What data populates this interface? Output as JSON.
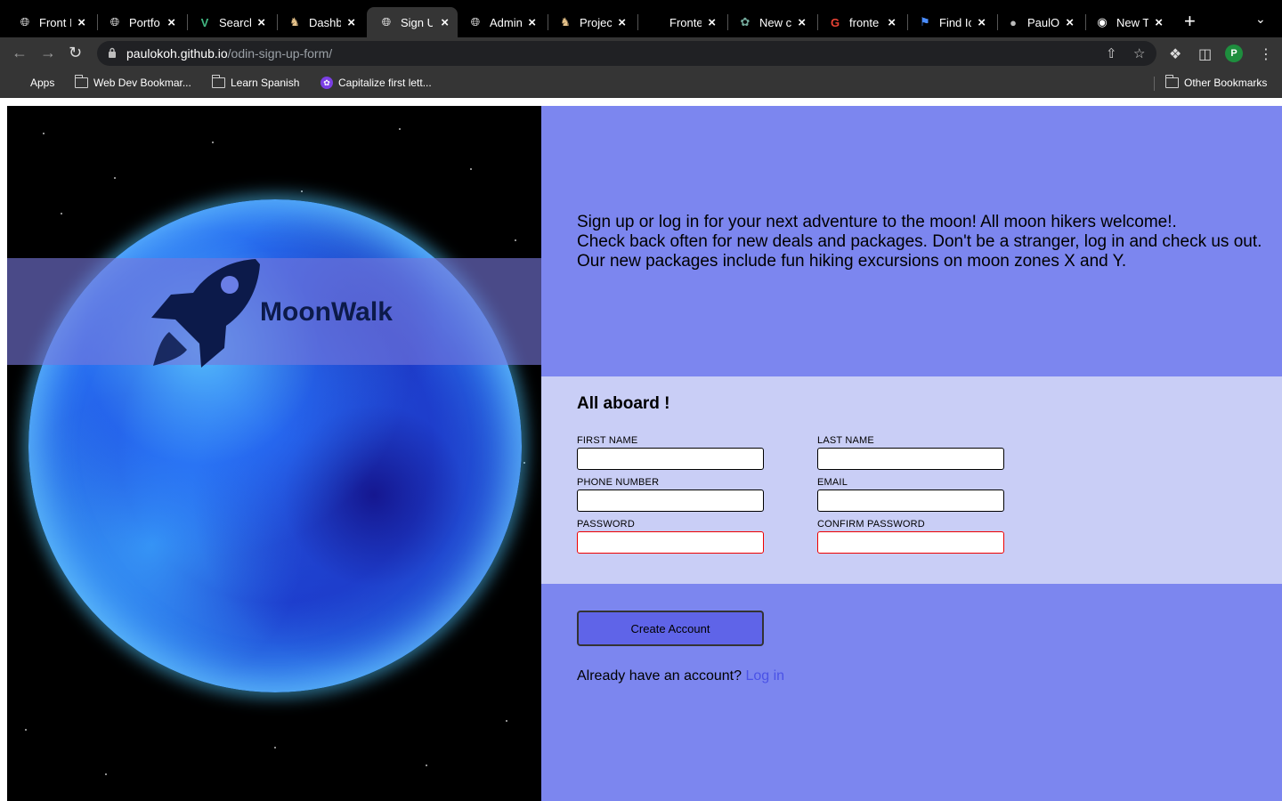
{
  "browser": {
    "tabs": [
      {
        "title": "Front I",
        "favicon": "globe-icon"
      },
      {
        "title": "Portfo",
        "favicon": "globe-icon"
      },
      {
        "title": "Search",
        "favicon": "vue-icon"
      },
      {
        "title": "Dashb",
        "favicon": "odin-icon"
      },
      {
        "title": "Sign U",
        "favicon": "globe-icon",
        "active": true
      },
      {
        "title": "Admin",
        "favicon": "globe-icon"
      },
      {
        "title": "Projec",
        "favicon": "odin-icon"
      },
      {
        "title": "Fronte",
        "favicon": "blank-icon"
      },
      {
        "title": "New c",
        "favicon": "openai-icon"
      },
      {
        "title": "fronte",
        "favicon": "google-icon"
      },
      {
        "title": "Find Ic",
        "favicon": "flag-icon"
      },
      {
        "title": "PaulO",
        "favicon": "github-icon"
      },
      {
        "title": "New T",
        "favicon": "chrome-icon"
      }
    ],
    "url_domain": "paulokoh.github.io",
    "url_path": "/odin-sign-up-form/",
    "profile_initial": "P",
    "bookmarks": [
      {
        "label": "Apps"
      },
      {
        "label": "Web Dev Bookmar..."
      },
      {
        "label": "Learn Spanish"
      },
      {
        "label": "Capitalize first lett..."
      }
    ],
    "other_bookmarks": "Other Bookmarks"
  },
  "hero": {
    "brand": "MoonWalk"
  },
  "intro": {
    "line1": "Sign up or log in for your next adventure to the moon! All moon hikers welcome!.",
    "line2": "Check back often for new deals and packages. Don't be a stranger, log in and check us out.",
    "line3": "Our new packages include fun hiking excursions on moon zones X and Y."
  },
  "form": {
    "heading": "All aboard !",
    "first_name": "FIRST NAME",
    "last_name": "LAST NAME",
    "phone": "PHONE NUMBER",
    "email": "EMAIL",
    "password": "PASSWORD",
    "confirm_password": "CONFIRM PASSWORD",
    "submit": "Create Account",
    "already": "Already have an account?",
    "login": "Log in"
  },
  "colors": {
    "accent": "#7c86ef",
    "form_bg": "#c9cef6",
    "button": "#5f64e8",
    "link": "#4a52e6",
    "error_border": "#e00000"
  }
}
